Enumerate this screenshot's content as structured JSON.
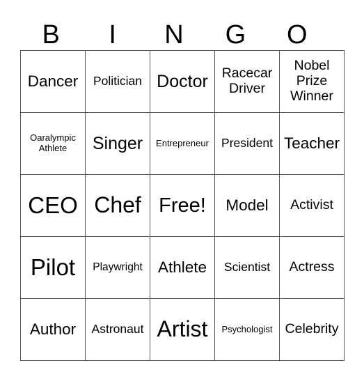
{
  "header": {
    "letters": [
      "B",
      "I",
      "N",
      "G",
      "O"
    ]
  },
  "grid": {
    "rows": [
      [
        "Dancer",
        "Politician",
        "Doctor",
        "Racecar Driver",
        "Nobel Prize Winner"
      ],
      [
        "Oaralympic Athlete",
        "Singer",
        "Entrepreneur",
        "President",
        "Teacher"
      ],
      [
        "CEO",
        "Chef",
        "Free!",
        "Model",
        "Activist"
      ],
      [
        "Pilot",
        "Playwright",
        "Athlete",
        "Scientist",
        "Actress"
      ],
      [
        "Author",
        "Astronaut",
        "Artist",
        "Psychologist",
        "Celebrity"
      ]
    ]
  }
}
